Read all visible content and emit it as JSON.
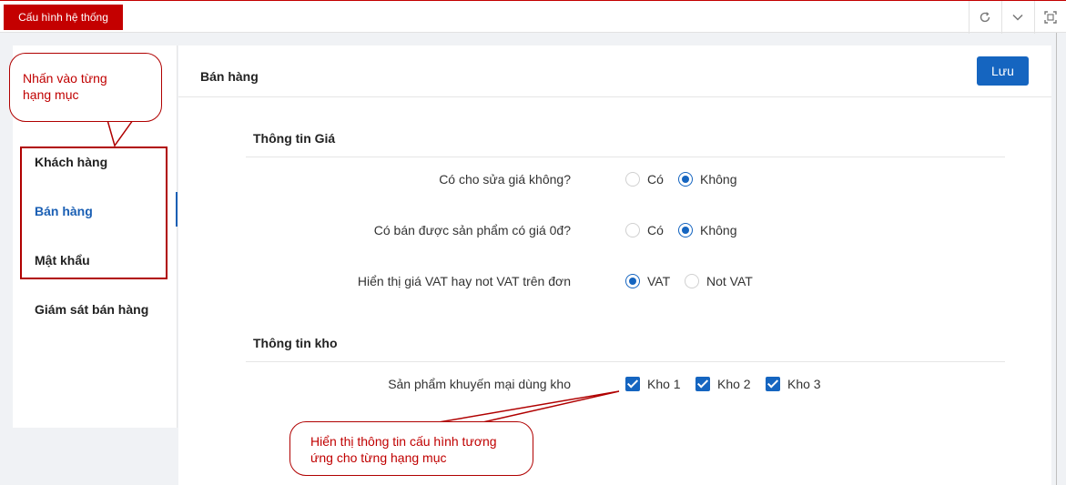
{
  "window": {
    "active_tab": "Cấu hình hệ thống",
    "icons": [
      "refresh-icon",
      "chevron-down-icon",
      "maximize-icon"
    ]
  },
  "sidebar": {
    "items": [
      {
        "label": "Khách hàng",
        "active": false
      },
      {
        "label": "Bán hàng",
        "active": true
      },
      {
        "label": "Mật khẩu",
        "active": false
      },
      {
        "label": "Giám sát bán hàng",
        "active": false
      }
    ]
  },
  "main": {
    "title": "Bán hàng",
    "save_label": "Lưu",
    "sections": [
      {
        "title": "Thông tin Giá",
        "rows": [
          {
            "label": "Có cho sửa giá không?",
            "options": [
              "Có",
              "Không"
            ],
            "selected": "Không"
          },
          {
            "label": "Có bán được sản phẩm có giá 0đ?",
            "options": [
              "Có",
              "Không"
            ],
            "selected": "Không"
          },
          {
            "label": "Hiển thị giá VAT hay not VAT trên đơn",
            "options": [
              "VAT",
              "Not VAT"
            ],
            "selected": "VAT"
          }
        ]
      },
      {
        "title": "Thông tin kho",
        "rows": [
          {
            "label": "Sản phẩm khuyến mại dùng kho",
            "checks": [
              "Kho 1",
              "Kho 2",
              "Kho 3"
            ],
            "checked": [
              "Kho 1",
              "Kho 2",
              "Kho 3"
            ]
          }
        ]
      }
    ]
  },
  "annotations": {
    "callout_sidebar": "Nhấn vào từng hạng mục",
    "callout_content": "Hiển thị thông tin cấu hình tương ứng cho từng hạng mục"
  },
  "colors": {
    "brand_red": "#c40000",
    "accent_blue": "#1565c0",
    "annotation_red": "#b00000"
  }
}
